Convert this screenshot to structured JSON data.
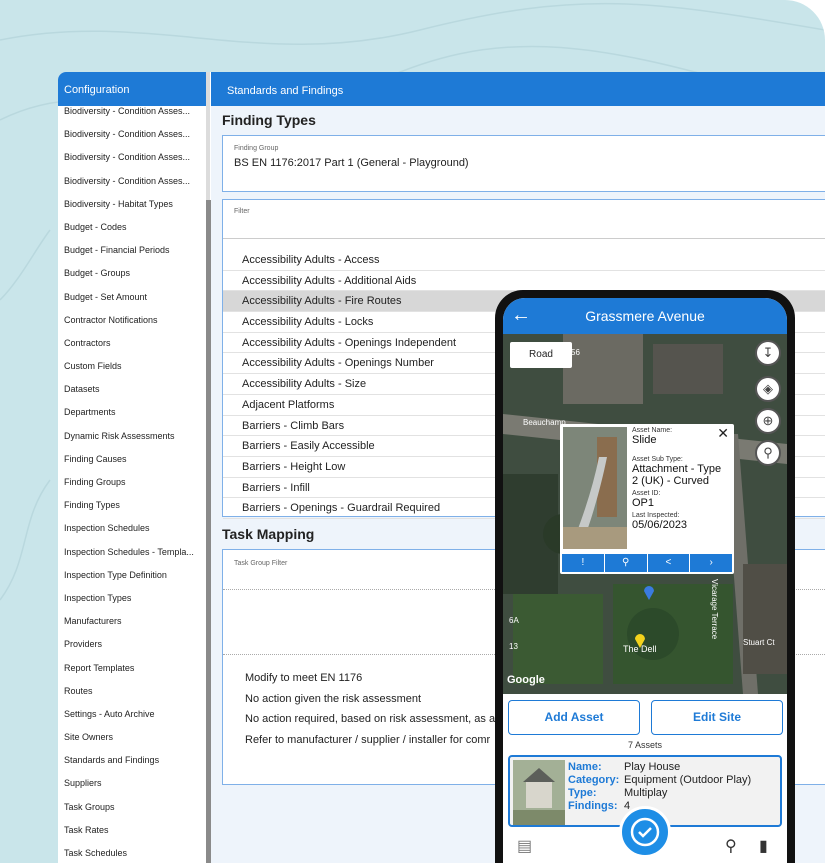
{
  "sidebar": {
    "title": "Configuration",
    "items": [
      "Biodiversity - Condition Asses...",
      "Biodiversity - Condition Asses...",
      "Biodiversity - Condition Asses...",
      "Biodiversity - Condition Asses...",
      "Biodiversity - Habitat Types",
      "Budget - Codes",
      "Budget - Financial Periods",
      "Budget - Groups",
      "Budget - Set Amount",
      "Contractor Notifications",
      "Contractors",
      "Custom Fields",
      "Datasets",
      "Departments",
      "Dynamic Risk Assessments",
      "Finding Causes",
      "Finding Groups",
      "Finding Types",
      "Inspection Schedules",
      "Inspection Schedules - Templa...",
      "Inspection Type Definition",
      "Inspection Types",
      "Manufacturers",
      "Providers",
      "Report Templates",
      "Routes",
      "Settings - Auto Archive",
      "Site Owners",
      "Standards and Findings",
      "Suppliers",
      "Task Groups",
      "Task Rates",
      "Task Schedules"
    ]
  },
  "main": {
    "header": "Standards and Findings",
    "finding_types_title": "Finding Types",
    "finding_group_label": "Finding Group",
    "finding_group_value": "BS EN 1176:2017 Part 1 (General - Playground)",
    "filter_label": "Filter",
    "findings": [
      "Accessibility Adults - Access",
      "Accessibility Adults - Additional Aids",
      "Accessibility Adults - Fire Routes",
      "Accessibility Adults - Locks",
      "Accessibility Adults - Openings Independent",
      "Accessibility Adults - Openings Number",
      "Accessibility Adults - Size",
      "Adjacent Platforms",
      "Barriers - Climb Bars",
      "Barriers - Easily Accessible",
      "Barriers - Height Low",
      "Barriers - Infill",
      "Barriers - Openings - Guardrail Required"
    ],
    "task_mapping_title": "Task Mapping",
    "task_group_filter_label": "Task Group Filter",
    "tasks": [
      "Modify to meet EN 1176",
      "No action given the risk assessment",
      "No action required, based on risk assessment, as as",
      "Refer to manufacturer / supplier / installer for comr"
    ]
  },
  "phone": {
    "title": "Grassmere Avenue",
    "map_type": "Road",
    "map_labels": [
      "Beauchamp",
      "The Dell",
      "Stuart Ct",
      "Vicarage Terrace",
      "6A",
      "13",
      "56"
    ],
    "google": "Google",
    "popup": {
      "asset_name_label": "Asset Name:",
      "asset_name": "Slide",
      "sub_type_label": "Asset Sub Type:",
      "sub_type": "Attachment - Type 2 (UK) - Curved",
      "asset_id_label": "Asset ID:",
      "asset_id": "OP1",
      "last_inspected_label": "Last Inspected:",
      "last_inspected": "05/06/2023"
    },
    "add_asset": "Add Asset",
    "edit_site": "Edit Site",
    "asset_count": "7 Assets",
    "card": {
      "name_label": "Name:",
      "name": "Play House",
      "category_label": "Category:",
      "category": "Equipment (Outdoor Play)",
      "type_label": "Type:",
      "type": "Multiplay",
      "findings_label": "Findings:",
      "findings": "4"
    }
  },
  "colors": {
    "accent": "#1e7ad6",
    "background": "#c9e5ea",
    "selected_row": "#d7d7d7"
  },
  "icons": [
    "back-arrow-icon",
    "fit-bounds-icon",
    "layers-icon",
    "locate-icon",
    "place-pin-icon",
    "close-icon",
    "alert-icon",
    "search-icon",
    "share-icon",
    "next-icon",
    "document-icon",
    "check-icon",
    "search-x-icon",
    "chat-icon"
  ]
}
